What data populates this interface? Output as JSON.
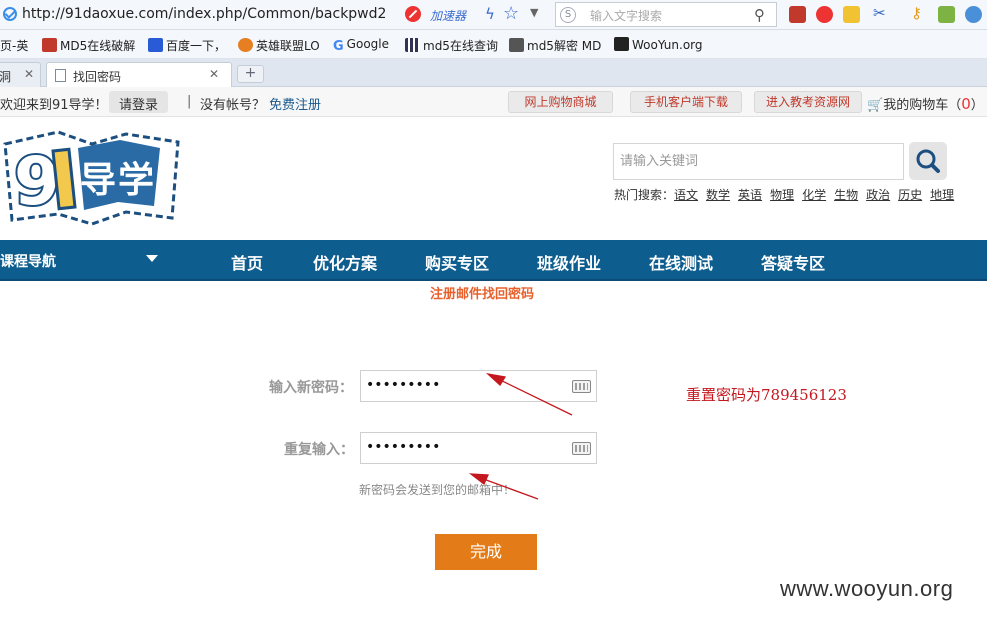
{
  "browser": {
    "url": "http://91daoxue.com/index.php/Common/backpwd2",
    "accelerator": "加速器",
    "search_placeholder": "输入文字搜索",
    "bookmarks": [
      "页-英",
      "MD5在线破解",
      "百度一下，",
      "英雄联盟LO",
      "Google",
      "md5在线查询",
      "md5解密 MD",
      "WooYun.org"
    ],
    "tabs": [
      {
        "title": "洞"
      },
      {
        "title": "找回密码"
      }
    ],
    "new_tab": "+"
  },
  "topbar": {
    "welcome": "欢迎来到91导学！",
    "login": "请登录",
    "sep": "|",
    "no_account": "没有帐号？",
    "register": "免费注册",
    "shop": "网上购物商城",
    "mobile": "手机客户端下载",
    "resources": "进入教考资源网",
    "cart": "我的购物车（",
    "cart_count": "0",
    "cart_close": "）"
  },
  "header": {
    "logo_text": "91导学",
    "search_placeholder": "请输入关键词",
    "hot_label": "热门搜索：",
    "hot_keywords": [
      "语文",
      "数学",
      "英语",
      "物理",
      "化学",
      "生物",
      "政治",
      "历史",
      "地理"
    ]
  },
  "nav": {
    "category": "课程导航",
    "items": [
      "首页",
      "优化方案",
      "购买专区",
      "班级作业",
      "在线测试",
      "答疑专区"
    ]
  },
  "form": {
    "title": "注册邮件找回密码",
    "new_password_label": "输入新密码：",
    "new_password_value": "•••••••••",
    "repeat_label": "重复输入：",
    "repeat_value": "•••••••••",
    "hint": "新密码会发送到您的邮箱中！",
    "submit": "完成"
  },
  "annotation": "重置密码为789456123",
  "watermark": "www.wooyun.org",
  "colors": {
    "nav_bg": "#0e5d8f",
    "accent_orange": "#e37c18",
    "title_orange": "#e8612c",
    "annotation_red": "#c4171e"
  }
}
